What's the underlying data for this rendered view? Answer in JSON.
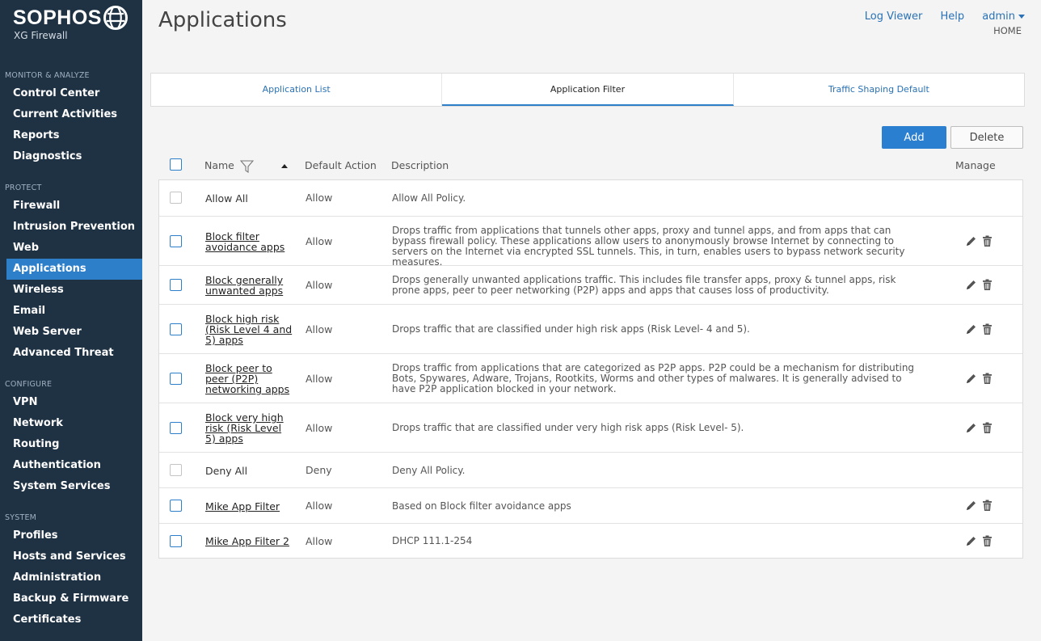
{
  "brand": {
    "name": "SOPHOS",
    "product": "XG Firewall"
  },
  "sidebar": {
    "sections": [
      {
        "title": "MONITOR & ANALYZE",
        "items": [
          "Control Center",
          "Current Activities",
          "Reports",
          "Diagnostics"
        ]
      },
      {
        "title": "PROTECT",
        "items": [
          "Firewall",
          "Intrusion Prevention",
          "Web",
          "Applications",
          "Wireless",
          "Email",
          "Web Server",
          "Advanced Threat"
        ]
      },
      {
        "title": "CONFIGURE",
        "items": [
          "VPN",
          "Network",
          "Routing",
          "Authentication",
          "System Services"
        ]
      },
      {
        "title": "SYSTEM",
        "items": [
          "Profiles",
          "Hosts and Services",
          "Administration",
          "Backup & Firmware",
          "Certificates"
        ]
      }
    ],
    "active_item": "Applications"
  },
  "header": {
    "title": "Applications",
    "links": {
      "log_viewer": "Log Viewer",
      "help": "Help",
      "admin": "admin"
    },
    "crumb": "HOME"
  },
  "tabs": [
    {
      "label": "Application List",
      "active": false
    },
    {
      "label": "Application Filter",
      "active": true
    },
    {
      "label": "Traffic Shaping Default",
      "active": false
    }
  ],
  "toolbar": {
    "add_label": "Add",
    "delete_label": "Delete"
  },
  "table": {
    "columns": {
      "name": "Name",
      "default_action": "Default Action",
      "description": "Description",
      "manage": "Manage"
    },
    "rows": [
      {
        "name": "Allow All",
        "action": "Allow",
        "description": "Allow All Policy.",
        "editable": false
      },
      {
        "name": "Block filter avoidance apps",
        "action": "Allow",
        "description": "Drops traffic from applications that tunnels other apps, proxy and tunnel apps, and from apps that can bypass firewall policy. These applications allow users to anonymously browse Internet by connecting to servers on the Internet via encrypted SSL tunnels. This, in turn, enables users to bypass network security measures.",
        "editable": true
      },
      {
        "name": "Block generally unwanted apps",
        "action": "Allow",
        "description": "Drops generally unwanted applications traffic. This includes file transfer apps, proxy & tunnel apps, risk prone apps, peer to peer networking (P2P) apps and apps that causes loss of productivity.",
        "editable": true
      },
      {
        "name": "Block high risk (Risk Level 4 and 5) apps",
        "action": "Allow",
        "description": "Drops traffic that are classified under high risk apps (Risk Level- 4 and 5).",
        "editable": true
      },
      {
        "name": "Block peer to peer (P2P) networking apps",
        "action": "Allow",
        "description": "Drops traffic from applications that are categorized as P2P apps. P2P could be a mechanism for distributing Bots, Spywares, Adware, Trojans, Rootkits, Worms and other types of malwares. It is generally advised to have P2P application blocked in your network.",
        "editable": true
      },
      {
        "name": "Block very high risk (Risk Level 5) apps",
        "action": "Allow",
        "description": "Drops traffic that are classified under very high risk apps (Risk Level- 5).",
        "editable": true
      },
      {
        "name": "Deny All",
        "action": "Deny",
        "description": "Deny All Policy.",
        "editable": false
      },
      {
        "name": "Mike App Filter",
        "action": "Allow",
        "description": "Based on Block filter avoidance apps",
        "editable": true
      },
      {
        "name": "Mike App Filter 2",
        "action": "Allow",
        "description": "DHCP 111.1-254",
        "editable": true
      }
    ]
  },
  "colors": {
    "sidebar_bg": "#1f3244",
    "accent": "#2d7fc9",
    "link": "#2a72b5"
  },
  "icons": {
    "logo": "globe-icon",
    "filter": "filter-icon",
    "sort": "sort-ascending-icon",
    "edit": "pencil-icon",
    "delete": "trash-icon"
  }
}
